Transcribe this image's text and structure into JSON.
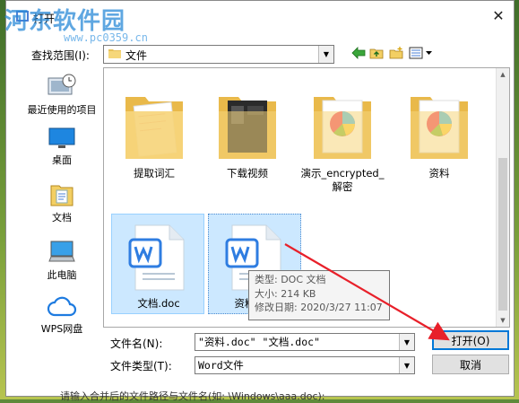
{
  "dialog": {
    "title": "打开",
    "watermark": "河东软件园",
    "watermark_url": "www.pc0359.cn"
  },
  "lookin": {
    "label": "查找范围(I):",
    "value": "文件"
  },
  "places": [
    {
      "label": "最近使用的项目",
      "icon": "recent-icon"
    },
    {
      "label": "桌面",
      "icon": "desktop-icon"
    },
    {
      "label": "文档",
      "icon": "documents-icon"
    },
    {
      "label": "此电脑",
      "icon": "computer-icon"
    },
    {
      "label": "WPS网盘",
      "icon": "cloud-icon"
    }
  ],
  "items": [
    {
      "name": "提取词汇",
      "type": "folder"
    },
    {
      "name": "下载视频",
      "type": "folder"
    },
    {
      "name": "演示_encrypted_解密",
      "type": "folder"
    },
    {
      "name": "资料",
      "type": "folder"
    },
    {
      "name": "文档.doc",
      "type": "doc"
    },
    {
      "name": "资料.doc",
      "type": "doc"
    }
  ],
  "tooltip": {
    "type": "类型: DOC 文档",
    "size": "大小: 214 KB",
    "date": "修改日期: 2020/3/27 11:07"
  },
  "filename": {
    "label": "文件名(N):",
    "value": "\"资料.doc\" \"文档.doc\""
  },
  "filetype": {
    "label": "文件类型(T):",
    "value": "Word文件"
  },
  "buttons": {
    "open": "打开(O)",
    "cancel": "取消"
  },
  "bottom_hint": "请输入合并后的文件路径与文件名(如: \\Windows\\aaa.doc):",
  "colors": {
    "accent": "#0078d7",
    "selection": "#cce8ff",
    "arrow": "#e8202a"
  }
}
